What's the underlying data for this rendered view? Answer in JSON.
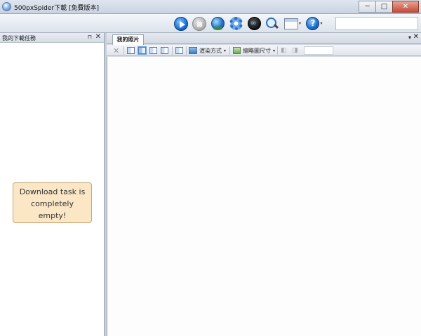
{
  "window": {
    "title": "500pxSpider下載 [免費版本]",
    "buttons": {
      "minimize": "─",
      "maximize": "□",
      "close": "✕"
    }
  },
  "toolbar": {
    "items": [
      {
        "icon": "play-icon"
      },
      {
        "icon": "stop-icon"
      },
      {
        "icon": "globe-icon"
      },
      {
        "icon": "gear-icon"
      },
      {
        "icon": "dark-circle-icon"
      },
      {
        "icon": "magnifier-icon"
      },
      {
        "icon": "window-icon",
        "dropdown": true
      },
      {
        "icon": "help-icon",
        "dropdown": true
      }
    ],
    "help_glyph": "?",
    "dropdown_glyph": "▾",
    "search_value": ""
  },
  "left_panel": {
    "title": "我的下載任務",
    "pin_glyph": "⊓",
    "close_glyph": "✕",
    "empty_message": "Download task is\ncompletely\nempty!"
  },
  "right_panel": {
    "tab_label": "我的照片",
    "tab_menu_glyph": "▾",
    "tab_close_glyph": "✕",
    "subtoolbar": {
      "delete_glyph": "✕",
      "render_mode_label": "渲染方式",
      "thumbnail_size_label": "縮略圖尺寸",
      "caret_glyph": "▾",
      "filter_value": ""
    }
  }
}
